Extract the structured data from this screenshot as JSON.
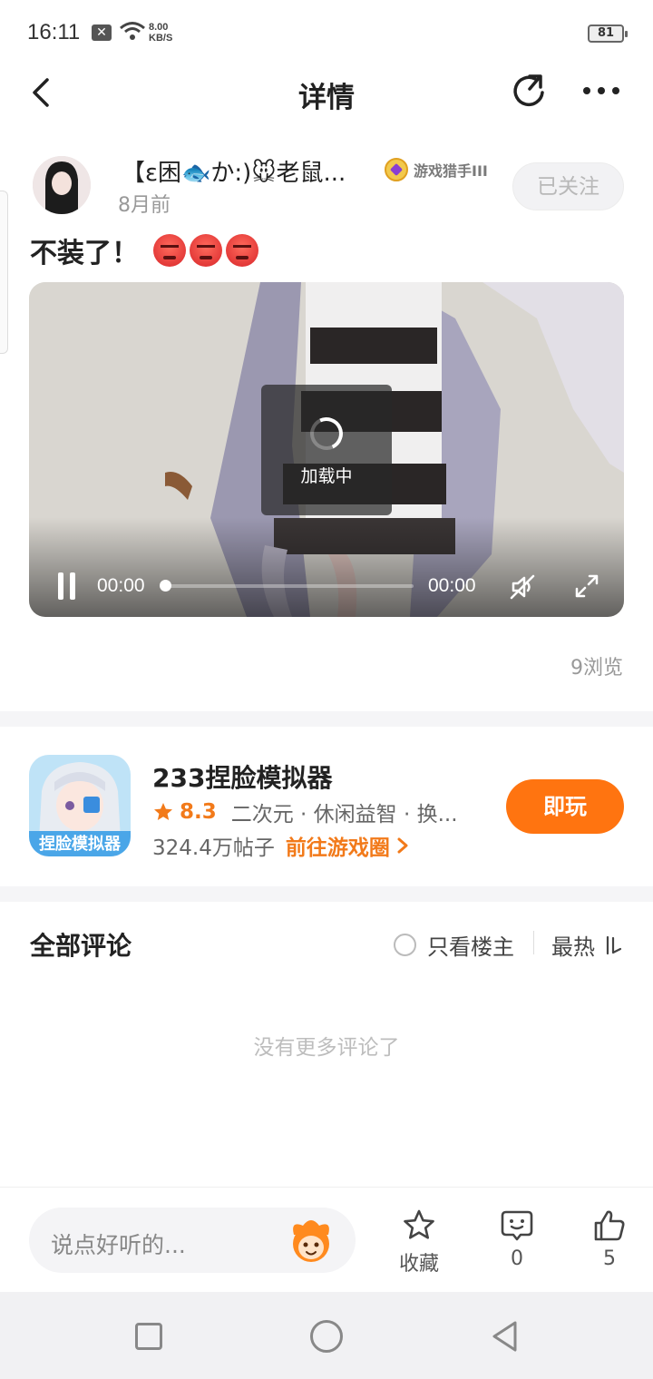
{
  "status_bar": {
    "time": "16:11",
    "net_speed_value": "8.00",
    "net_speed_unit": "KB/S",
    "battery": "81"
  },
  "header": {
    "title": "详情"
  },
  "author": {
    "name": "【ε困🐟か:)🐭老鼠...",
    "badge": "游戏猎手III",
    "time": "8月前",
    "follow_label": "已关注"
  },
  "post": {
    "title": "不装了！",
    "views": "9浏览"
  },
  "video": {
    "loading_text": "加载中",
    "current_time": "00:00",
    "total_time": "00:00",
    "progress": 0
  },
  "game": {
    "name": "233捏脸模拟器",
    "rating": "8.3",
    "tags": "二次元 · 休闲益智 · 换...",
    "posts": "324.4万帖子",
    "goto_label": "前往游戏圈",
    "play_label": "即玩",
    "accent": "#ff7410"
  },
  "comments": {
    "title": "全部评论",
    "only_owner_label": "只看楼主",
    "sort_label": "最热",
    "empty_text": "没有更多评论了"
  },
  "action_bar": {
    "placeholder": "说点好听的...",
    "favorite_label": "收藏",
    "comment_count": "0",
    "like_count": "5"
  }
}
